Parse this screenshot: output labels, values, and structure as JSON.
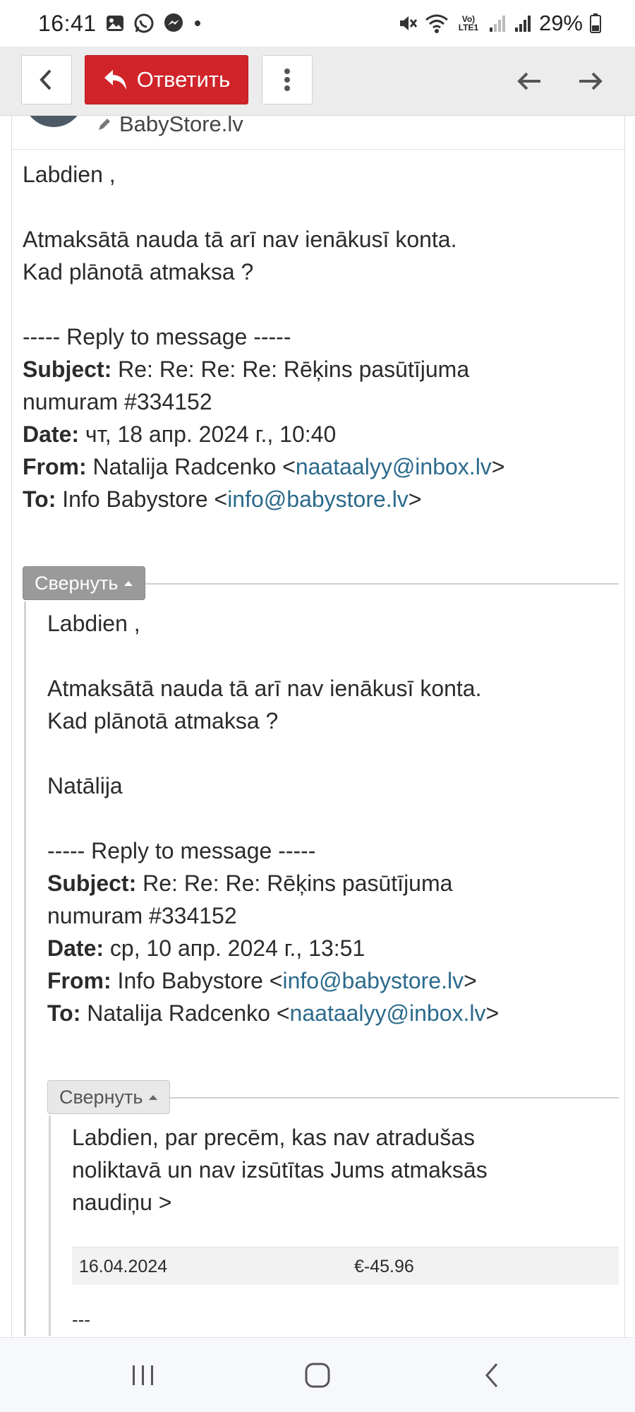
{
  "status_bar": {
    "time": "16:41",
    "battery": "29%",
    "network_label": "Vo) LTE1"
  },
  "toolbar": {
    "reply_label": "Ответить"
  },
  "sender": {
    "name": "BabyStore.lv"
  },
  "message": {
    "greeting": "Labdien ,",
    "text_1": "Atmaksātā nauda tā arī nav ienākusī konta.",
    "text_2": "Kad plānotā atmaksa ?",
    "reply_divider": "----- Reply to message -----",
    "subject_label": "Subject:",
    "subject_1": "Re: Re: Re: Re: Rēķins pasūtījuma",
    "subject_2": "numuram #334152",
    "date_label": "Date:",
    "date": "чт, 18 апр. 2024 г., 10:40",
    "from_label": "From:",
    "from_name": "Natalija Radcenko <",
    "from_email": "naataalyy@inbox.lv",
    "to_label": "To:",
    "to_name": "Info Babystore <",
    "to_email": "info@babystore.lv",
    "close_bracket": ">"
  },
  "collapse_label": "Свернуть",
  "quote_1": {
    "greeting": "Labdien ,",
    "text_1": "Atmaksātā nauda tā arī nav ienākusī konta.",
    "text_2": "Kad plānotā atmaksa ?",
    "signature": "Natālija",
    "reply_divider": "----- Reply to message -----",
    "subject_label": "Subject:",
    "subject_1": "Re: Re: Re: Rēķins pasūtījuma",
    "subject_2": "numuram #334152",
    "date_label": "Date:",
    "date": "ср, 10 апр. 2024 г., 13:51",
    "from_label": "From:",
    "from_name": "Info Babystore <",
    "from_email": "info@babystore.lv",
    "to_label": "To:",
    "to_name": "Natalija Radcenko <",
    "to_email": "naataalyy@inbox.lv",
    "close_bracket": ">"
  },
  "quote_2": {
    "text_1": "Labdien, par precēm, kas nav atradušas",
    "text_2": "noliktavā un nav izsūtītas Jums atmaksās",
    "text_3": "naudiņu >",
    "table": [
      {
        "date": "16.04.2024",
        "amount": "€-45.96"
      }
    ],
    "trailer": "---"
  }
}
